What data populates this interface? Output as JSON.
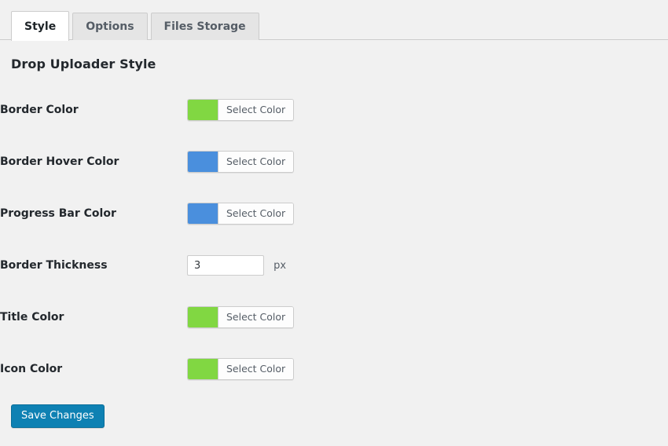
{
  "tabs": [
    {
      "label": "Style",
      "active": true
    },
    {
      "label": "Options",
      "active": false
    },
    {
      "label": "Files Storage",
      "active": false
    }
  ],
  "heading": "Drop Uploader Style",
  "colors": {
    "green": "#81d742",
    "blue": "#4a8fdd",
    "primary_button": "#0e81b3",
    "page_background": "#f1f1f1",
    "active_tab_background": "#ffffff",
    "inactive_tab_background": "#e5e5e5"
  },
  "select_color_label": "Select Color",
  "rows": [
    {
      "label": "Border Color",
      "type": "color",
      "button_label": "Select Color",
      "swatch": "#81d742"
    },
    {
      "label": "Border Hover Color",
      "type": "color",
      "button_label": "Select Color",
      "swatch": "#4a8fdd"
    },
    {
      "label": "Progress Bar Color",
      "type": "color",
      "button_label": "Select Color",
      "swatch": "#4a8fdd"
    },
    {
      "label": "Border Thickness",
      "type": "number",
      "value": "3",
      "placeholder": "",
      "unit": "px"
    },
    {
      "label": "Title Color",
      "type": "color",
      "button_label": "Select Color",
      "swatch": "#81d742"
    },
    {
      "label": "Icon Color",
      "type": "color",
      "button_label": "Select Color",
      "swatch": "#81d742"
    }
  ],
  "submit": {
    "label": "Save Changes"
  }
}
